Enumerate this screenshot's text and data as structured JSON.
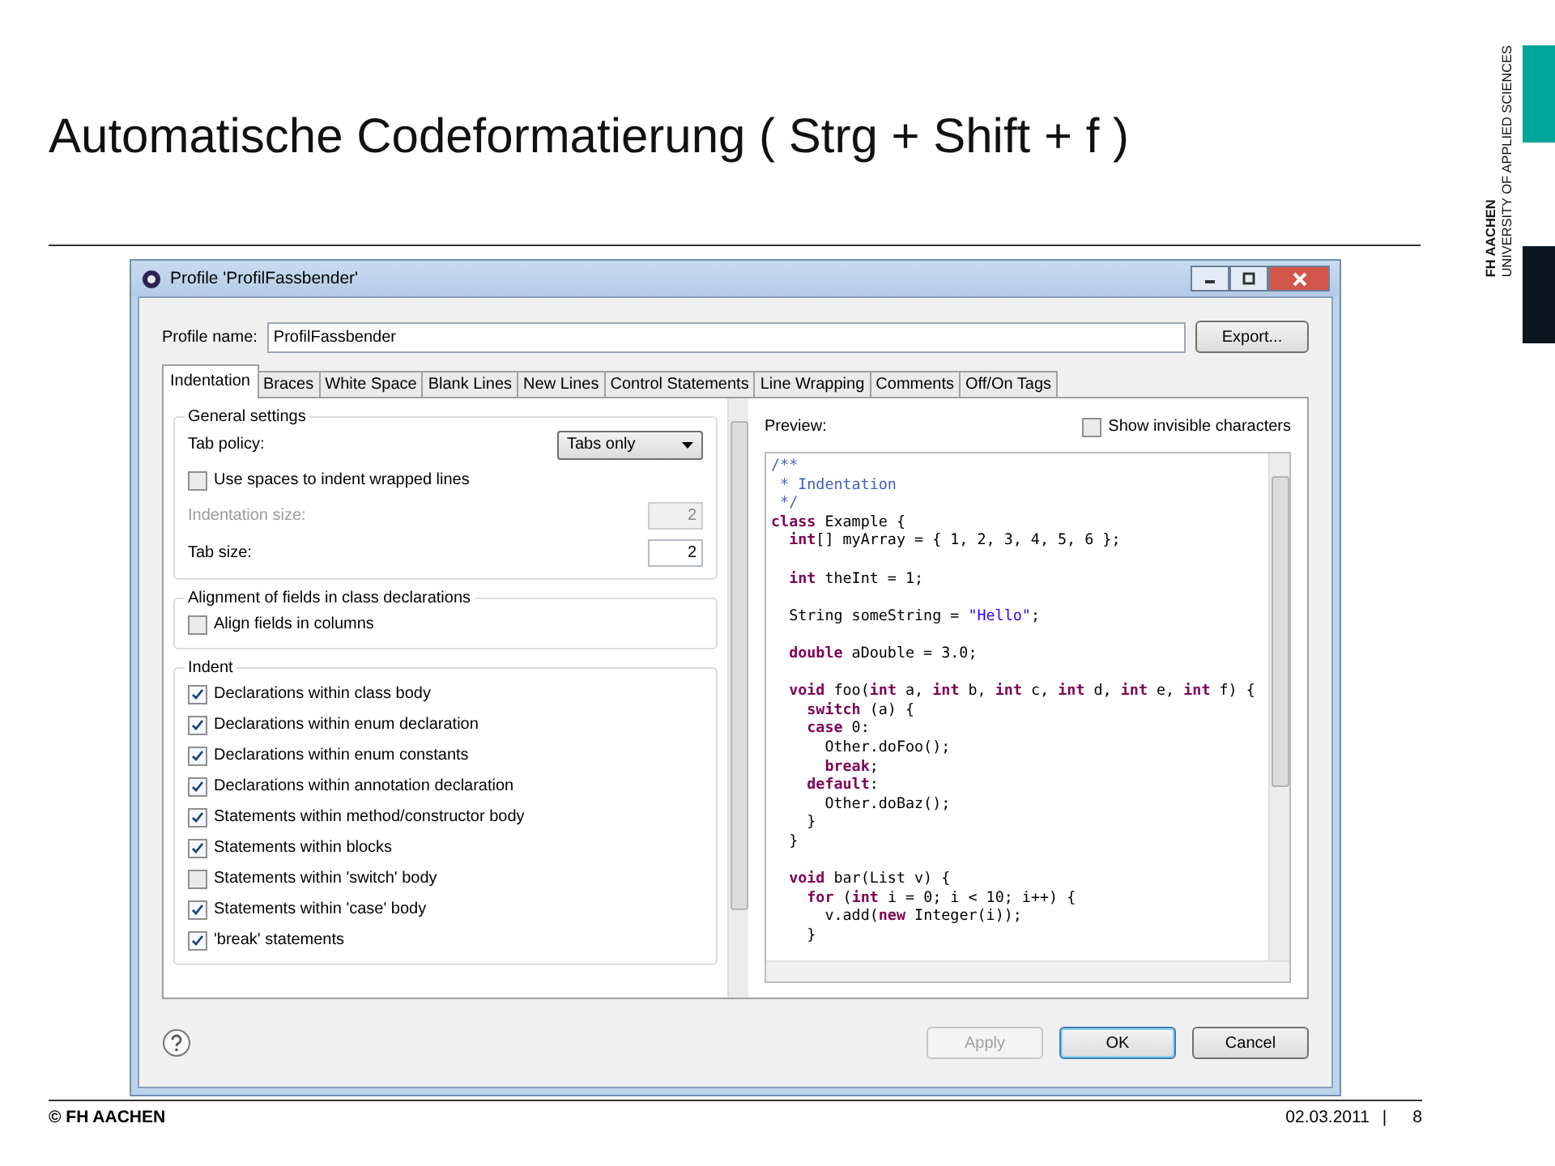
{
  "slide": {
    "title": "Automatische Codeformatierung ( Strg + Shift + f )",
    "logo": {
      "name": "FH AACHEN",
      "subtitle": "UNIVERSITY OF APPLIED SCIENCES"
    },
    "footer": {
      "copyright": "© FH AACHEN",
      "date": "02.03.2011",
      "separator": "|",
      "page": "8"
    }
  },
  "window": {
    "title": "Profile 'ProfilFassbender'",
    "profile_name": {
      "label": "Profile name:",
      "value": "ProfilFassbender"
    },
    "export_button": "Export...",
    "tabs": [
      {
        "label": "Indentation",
        "selected": true
      },
      {
        "label": "Braces",
        "selected": false
      },
      {
        "label": "White Space",
        "selected": false
      },
      {
        "label": "Blank Lines",
        "selected": false
      },
      {
        "label": "New Lines",
        "selected": false
      },
      {
        "label": "Control Statements",
        "selected": false
      },
      {
        "label": "Line Wrapping",
        "selected": false
      },
      {
        "label": "Comments",
        "selected": false
      },
      {
        "label": "Off/On Tags",
        "selected": false
      }
    ],
    "general_settings": {
      "title": "General settings",
      "tab_policy": {
        "label": "Tab policy:",
        "value": "Tabs only"
      },
      "use_spaces": {
        "label": "Use spaces to indent wrapped lines",
        "checked": false
      },
      "fields": [
        {
          "label": "Indentation size:",
          "value": "2",
          "disabled": true
        },
        {
          "label": "Tab size:",
          "value": "2",
          "disabled": false
        }
      ]
    },
    "alignment": {
      "title": "Alignment of fields in class declarations",
      "options": [
        {
          "label": "Align fields in columns",
          "checked": false
        }
      ]
    },
    "indent": {
      "title": "Indent",
      "options": [
        {
          "label": "Declarations within class body",
          "checked": true
        },
        {
          "label": "Declarations within enum declaration",
          "checked": true
        },
        {
          "label": "Declarations within enum constants",
          "checked": true
        },
        {
          "label": "Declarations within annotation declaration",
          "checked": true
        },
        {
          "label": "Statements within method/constructor body",
          "checked": true
        },
        {
          "label": "Statements within blocks",
          "checked": true
        },
        {
          "label": "Statements within 'switch' body",
          "checked": false
        },
        {
          "label": "Statements within 'case' body",
          "checked": true
        },
        {
          "label": "'break' statements",
          "checked": true
        }
      ]
    },
    "preview": {
      "label": "Preview:",
      "show_invisible": {
        "label": "Show invisible characters",
        "checked": false
      },
      "code": [
        [
          {
            "kind": "comment",
            "text": "/**"
          }
        ],
        [
          {
            "kind": "comment",
            "text": " * Indentation"
          }
        ],
        [
          {
            "kind": "comment",
            "text": " */"
          }
        ],
        [
          {
            "kind": "keyword",
            "text": "class"
          },
          {
            "kind": "plain",
            "text": " Example {"
          }
        ],
        [
          {
            "kind": "keyword",
            "text": "  int"
          },
          {
            "kind": "plain",
            "text": "[] myArray = { 1, 2, 3, 4, 5, 6 };"
          }
        ],
        [
          {
            "kind": "blank"
          }
        ],
        [
          {
            "kind": "keyword",
            "text": "  int"
          },
          {
            "kind": "plain",
            "text": " theInt = 1;"
          }
        ],
        [
          {
            "kind": "blank"
          }
        ],
        [
          {
            "kind": "plain",
            "text": "  String someString = "
          },
          {
            "kind": "string",
            "text": "\"Hello\""
          },
          {
            "kind": "plain",
            "text": ";"
          }
        ],
        [
          {
            "kind": "blank"
          }
        ],
        [
          {
            "kind": "keyword",
            "text": "  double"
          },
          {
            "kind": "plain",
            "text": " aDouble = 3.0;"
          }
        ],
        [
          {
            "kind": "blank"
          }
        ],
        [
          {
            "kind": "keyword",
            "text": "  void"
          },
          {
            "kind": "plain",
            "text": " foo("
          },
          {
            "kind": "keyword",
            "text": "int"
          },
          {
            "kind": "plain",
            "text": " a, "
          },
          {
            "kind": "keyword",
            "text": "int"
          },
          {
            "kind": "plain",
            "text": " b, "
          },
          {
            "kind": "keyword",
            "text": "int"
          },
          {
            "kind": "plain",
            "text": " c, "
          },
          {
            "kind": "keyword",
            "text": "int"
          },
          {
            "kind": "plain",
            "text": " d, "
          },
          {
            "kind": "keyword",
            "text": "int"
          },
          {
            "kind": "plain",
            "text": " e, "
          },
          {
            "kind": "keyword",
            "text": "int"
          },
          {
            "kind": "plain",
            "text": " f) {"
          }
        ],
        [
          {
            "kind": "keyword",
            "text": "    switch"
          },
          {
            "kind": "plain",
            "text": " (a) {"
          }
        ],
        [
          {
            "kind": "keyword",
            "text": "    case"
          },
          {
            "kind": "plain",
            "text": " 0:"
          }
        ],
        [
          {
            "kind": "plain",
            "text": "      Other.doFoo();"
          }
        ],
        [
          {
            "kind": "keyword",
            "text": "      break"
          },
          {
            "kind": "plain",
            "text": ";"
          }
        ],
        [
          {
            "kind": "keyword",
            "text": "    default"
          },
          {
            "kind": "plain",
            "text": ":"
          }
        ],
        [
          {
            "kind": "plain",
            "text": "      Other.doBaz();"
          }
        ],
        [
          {
            "kind": "plain",
            "text": "    }"
          }
        ],
        [
          {
            "kind": "plain",
            "text": "  }"
          }
        ],
        [
          {
            "kind": "blank"
          }
        ],
        [
          {
            "kind": "keyword",
            "text": "  void"
          },
          {
            "kind": "plain",
            "text": " bar(List v) {"
          }
        ],
        [
          {
            "kind": "keyword",
            "text": "    for"
          },
          {
            "kind": "plain",
            "text": " ("
          },
          {
            "kind": "keyword",
            "text": "int"
          },
          {
            "kind": "plain",
            "text": " i = 0; i < 10; i++) {"
          }
        ],
        [
          {
            "kind": "plain",
            "text": "      v.add("
          },
          {
            "kind": "keyword",
            "text": "new"
          },
          {
            "kind": "plain",
            "text": " Integer(i));"
          }
        ],
        [
          {
            "kind": "plain",
            "text": "    }"
          }
        ]
      ]
    },
    "buttons": [
      {
        "label": "Apply",
        "disabled": true,
        "default": false
      },
      {
        "label": "OK",
        "disabled": false,
        "default": true
      },
      {
        "label": "Cancel",
        "disabled": false,
        "default": false
      }
    ]
  }
}
